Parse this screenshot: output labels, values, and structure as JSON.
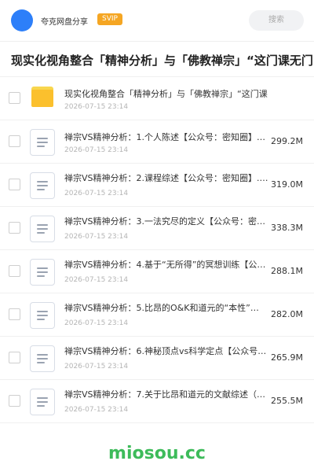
{
  "header": {
    "title": "夸克网盘分享",
    "badge": "SVIP",
    "search_placeholder": "搜索",
    "colors": {
      "avatar": "#2d7ff9",
      "badge": "#f5a623"
    }
  },
  "folder_title": "现实化视角整合「精神分析」与「佛教禅宗」“这门课无门",
  "files": [
    {
      "name": "现实化视角整合「精神分析」与「佛教禅宗」“这门课",
      "date": "2026-07-15 23:14",
      "size": "",
      "icon": "folder-icon"
    },
    {
      "name": "禅宗VS精神分析：1.个人陈述【公众号：密知圈】…",
      "date": "2026-07-15 23:14",
      "size": "299.2M",
      "icon": "document-icon"
    },
    {
      "name": "禅宗VS精神分析：2.课程综述【公众号：密知圈】.…",
      "date": "2026-07-15 23:14",
      "size": "319.0M",
      "icon": "document-icon"
    },
    {
      "name": "禅宗VS精神分析：3.一法究尽的定义【公众号：密知…",
      "date": "2026-07-15 23:14",
      "size": "338.3M",
      "icon": "document-icon"
    },
    {
      "name": "禅宗VS精神分析：4.基于“无所得”的冥想训练【公…",
      "date": "2026-07-15 23:14",
      "size": "288.1M",
      "icon": "document-icon"
    },
    {
      "name": "禅宗VS精神分析：5.比昂的O&K和道元的“本性”…",
      "date": "2026-07-15 23:14",
      "size": "282.0M",
      "icon": "document-icon"
    },
    {
      "name": "禅宗VS精神分析：6.神秘顶点vs科学定点【公众号…",
      "date": "2026-07-15 23:14",
      "size": "265.9M",
      "icon": "document-icon"
    },
    {
      "name": "禅宗VS精神分析：7.关于比昂和道元的文献综述（1…",
      "date": "2026-07-15 23:14",
      "size": "255.5M",
      "icon": "document-icon"
    }
  ],
  "watermark": "miosou.cc"
}
